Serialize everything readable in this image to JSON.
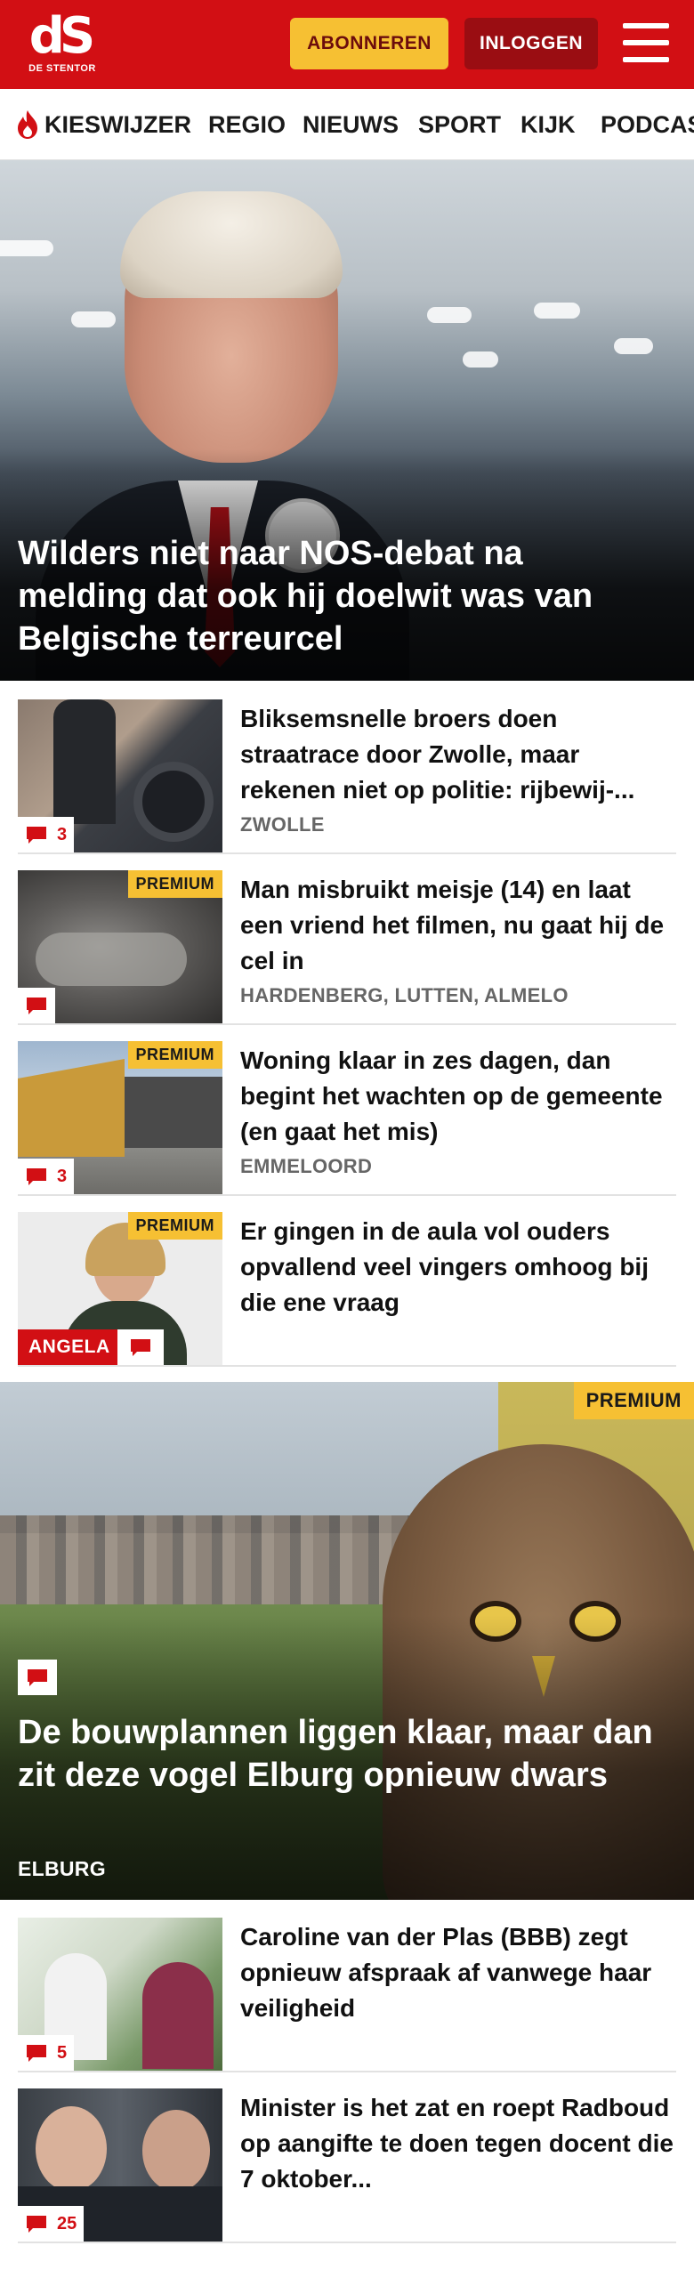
{
  "brand": {
    "logo_mark": "dS",
    "logo_sub": "DE STENTOR",
    "accent": "#d20f14",
    "premium_color": "#f6c033"
  },
  "header": {
    "subscribe_label": "ABONNEREN",
    "login_label": "INLOGGEN",
    "menu_icon": "hamburger-menu-icon"
  },
  "nav": {
    "items": [
      {
        "label": "KIESWIJZER",
        "icon": "flame-icon"
      },
      {
        "label": "REGIO"
      },
      {
        "label": "NIEUWS"
      },
      {
        "label": "SPORT"
      },
      {
        "label": "KIJK"
      },
      {
        "label": "PODCAST"
      }
    ]
  },
  "hero": {
    "title": "Wilders niet naar NOS-debat na melding dat ook hij doelwit was van Belgische terreurcel"
  },
  "articles": [
    {
      "title": "Bliksemsnelle broers doen straatrace door Zwolle, maar rekenen niet op politie: rijbewij-...",
      "location": "ZWOLLE",
      "comments": "3",
      "premium": ""
    },
    {
      "title": "Man misbruikt meisje (14) en laat een vriend het filmen, nu gaat hij de cel in",
      "location": "HARDENBERG, LUTTEN, ALMELO",
      "comments": "",
      "premium": "PREMIUM"
    },
    {
      "title": "Woning klaar in zes dagen, dan begint het wachten op de gemeente (en gaat het mis)",
      "location": "EMMELOORD",
      "comments": "3",
      "premium": "PREMIUM"
    },
    {
      "title": "Er gingen in de aula vol ouders opvallend veel vingers omhoog bij die ene vraag",
      "location": "",
      "comments": "",
      "premium": "PREMIUM",
      "author": "ANGELA"
    }
  ],
  "feature": {
    "premium": "PREMIUM",
    "title": "De bouwplannen liggen klaar, maar dan zit deze vogel Elburg opnieuw dwars",
    "location": "ELBURG"
  },
  "articles2": [
    {
      "title": "Caroline van der Plas (BBB) zegt opnieuw afspraak af vanwege haar veiligheid",
      "comments": "5"
    },
    {
      "title": "Minister is het zat en roept Radboud op aangifte te doen tegen docent die 7 oktober...",
      "comments": "25"
    }
  ]
}
